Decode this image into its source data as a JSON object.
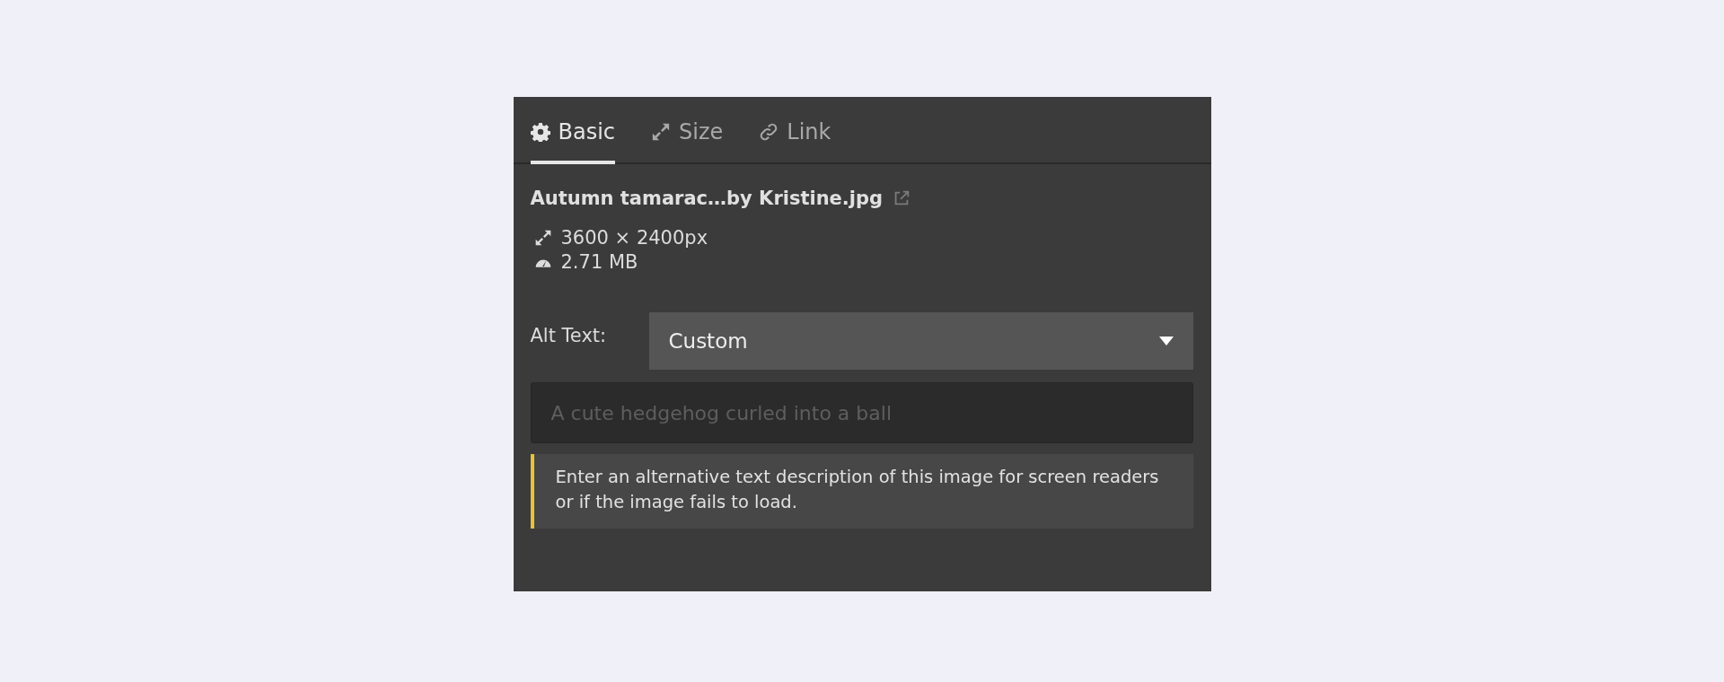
{
  "tabs": [
    {
      "label": "Basic",
      "kind": "settings",
      "selected": true
    },
    {
      "label": "Size",
      "kind": "size",
      "selected": false
    },
    {
      "label": "Link",
      "kind": "link",
      "selected": false
    }
  ],
  "file": {
    "name": "Autumn tamarac…by Kristine.jpg",
    "dimensions": "3600 × 2400px",
    "size": "2.71 MB"
  },
  "alt_text": {
    "label": "Alt Text:",
    "mode": "Custom",
    "placeholder": "A cute hedgehog curled into a ball",
    "hint": "Enter an alternative text description of this image for screen readers or if the image fails to load."
  }
}
